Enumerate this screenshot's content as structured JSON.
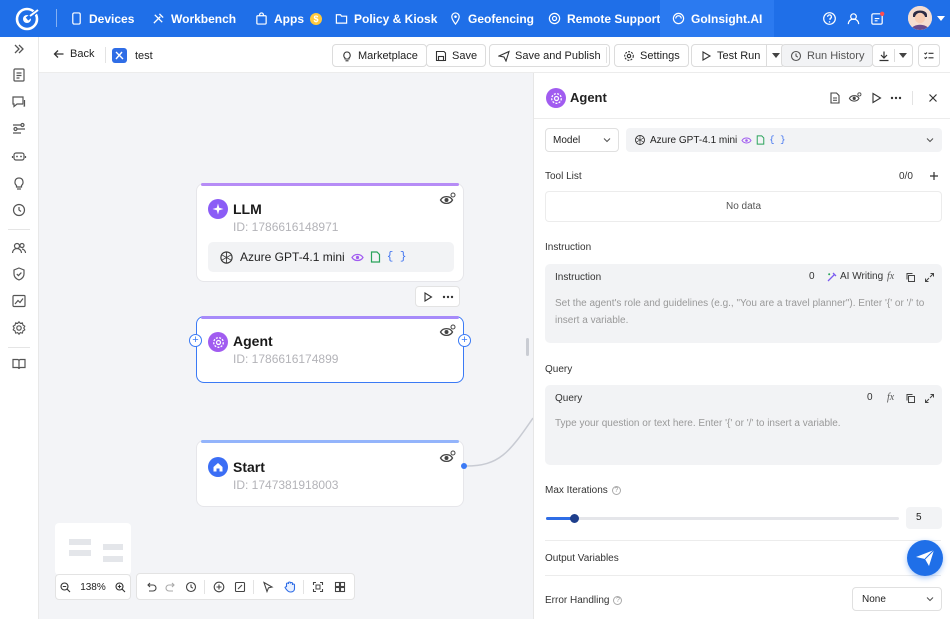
{
  "topnav": {
    "items": [
      {
        "label": "Devices"
      },
      {
        "label": "Workbench"
      },
      {
        "label": "Apps"
      },
      {
        "label": "Policy & Kiosk"
      },
      {
        "label": "Geofencing"
      },
      {
        "label": "Remote Support"
      },
      {
        "label": "GoInsight.AI"
      }
    ],
    "apps_badge": "$",
    "icons": [
      "help-icon",
      "user-switch-icon",
      "notification-icon",
      "avatar"
    ]
  },
  "subbar": {
    "back_label": "Back",
    "workflow_name": "test",
    "marketplace": "Marketplace",
    "save": "Save",
    "save_publish": "Save and Publish",
    "settings": "Settings",
    "test_run": "Test Run",
    "run_history": "Run History"
  },
  "nodes": {
    "llm": {
      "title": "LLM",
      "id": "ID: 1786616148971",
      "model": "Azure GPT-4.1 mini",
      "model_tag": "{ }"
    },
    "agent": {
      "title": "Agent",
      "id": "ID: 1786616174899"
    },
    "start": {
      "title": "Start",
      "id": "ID: 1747381918003"
    }
  },
  "canvas": {
    "zoom": "138%"
  },
  "panel": {
    "title": "Agent",
    "model_label": "Model",
    "model_value": "Azure GPT-4.1 mini",
    "model_tag": "{ }",
    "tool_list_label": "Tool List",
    "tool_count": "0/0",
    "no_data": "No data",
    "instruction_section": "Instruction",
    "instruction_header": "Instruction",
    "instruction_count": "0",
    "ai_writing": "AI Writing",
    "fx": "fx",
    "instruction_placeholder": "Set the agent's role and guidelines (e.g., \"You are a travel planner\"). Enter '{' or '/' to insert a variable.",
    "query_section": "Query",
    "query_header": "Query",
    "query_count": "0",
    "query_placeholder": "Type your question or text here. Enter '{' or '/' to insert a variable.",
    "max_iterations_label": "Max Iterations",
    "max_iterations_value": "5",
    "max_iterations_fraction": 0.08,
    "output_variables_label": "Output Variables",
    "error_handling_label": "Error Handling",
    "error_handling_value": "None"
  },
  "colors": {
    "brand": "#1f6fe8",
    "agent_purple": "#a15cf0",
    "start_blue": "#3b6ef5",
    "llm_purple": "#b68cf6"
  }
}
